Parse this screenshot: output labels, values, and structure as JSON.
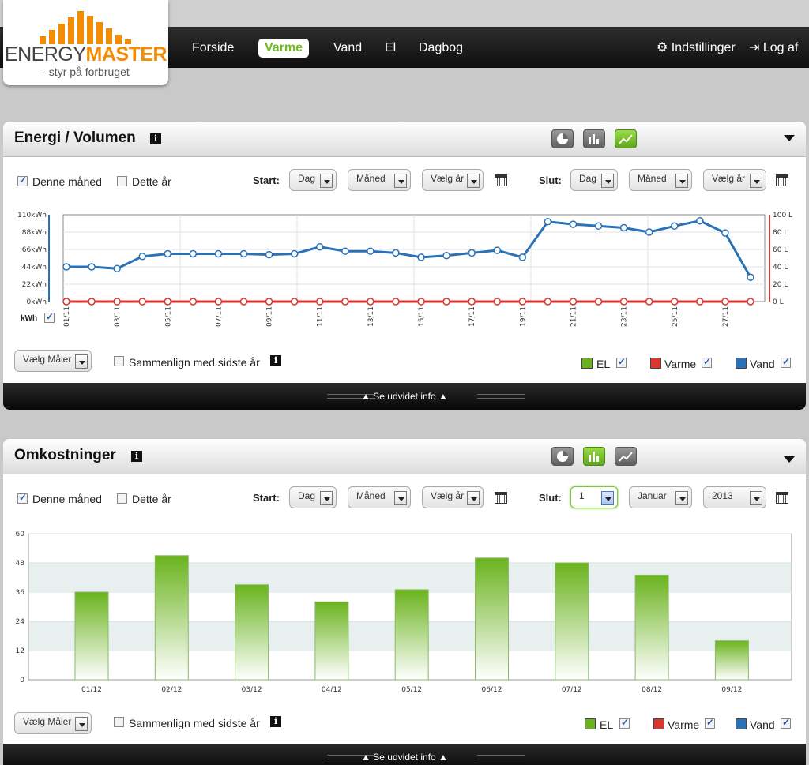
{
  "logo": {
    "word1": "ENERGY",
    "word2": "MASTER",
    "tagline": "- styr på forbruget"
  },
  "nav": {
    "items": [
      "Forside",
      "Varme",
      "Vand",
      "El",
      "Dagbog"
    ],
    "active": "Varme",
    "settings_label": "Indstillinger",
    "logout_label": "Log af"
  },
  "panel1": {
    "title": "Energi / Volumen",
    "info": "i",
    "this_month_label": "Denne måned",
    "this_year_label": "Dette år",
    "start_label": "Start",
    "end_label": "Slut:",
    "start_selects": [
      "Dag",
      "Måned",
      "Vælg år"
    ],
    "end_selects": [
      "Dag",
      "Måned",
      "Vælg år"
    ],
    "unit_toggle_label": "kWh",
    "meter_select": "Vælg Måler",
    "compare_label": "Sammenlign med sidste år",
    "legend": [
      {
        "label": "EL",
        "color": "#6ab31d"
      },
      {
        "label": "Varme",
        "color": "#d9362f"
      },
      {
        "label": "Vand",
        "color": "#2a72b8"
      }
    ],
    "expand_label": "Se udvidet info"
  },
  "panel2": {
    "title": "Omkostninger",
    "info": "i",
    "this_month_label": "Denne måned",
    "this_year_label": "Dette år",
    "start_label": "Start",
    "end_label": "Slut:",
    "start_selects": [
      "Dag",
      "Måned",
      "Vælg år"
    ],
    "end_selects": [
      "1",
      "Januar",
      "2013"
    ],
    "meter_select": "Vælg Måler",
    "compare_label": "Sammenlign med sidste år",
    "legend": [
      {
        "label": "EL",
        "color": "#6ab31d"
      },
      {
        "label": "Varme",
        "color": "#d9362f"
      },
      {
        "label": "Vand",
        "color": "#2a72b8"
      }
    ],
    "expand_label": "Se udvidet info"
  },
  "chart_data": [
    {
      "type": "line",
      "x": [
        "01/11",
        "02/11",
        "03/11",
        "04/11",
        "05/11",
        "06/11",
        "07/11",
        "08/11",
        "09/11",
        "10/11",
        "11/11",
        "12/11",
        "13/11",
        "14/11",
        "15/11",
        "16/11",
        "17/11",
        "18/11",
        "19/11",
        "20/11",
        "21/11",
        "22/11",
        "23/11",
        "24/11",
        "25/11",
        "26/11",
        "27/11",
        "28/11"
      ],
      "x_tick_labels": [
        "01/11",
        "03/11",
        "05/11",
        "07/11",
        "09/11",
        "11/11",
        "13/11",
        "15/11",
        "17/11",
        "19/11",
        "21/11",
        "23/11",
        "25/11",
        "27/11"
      ],
      "series": [
        {
          "name": "Vand",
          "axis": "right",
          "color": "#2a72b8",
          "values": [
            40,
            40,
            38,
            52,
            55,
            55,
            55,
            55,
            54,
            55,
            63,
            58,
            58,
            56,
            51,
            53,
            56,
            59,
            51,
            92,
            89,
            87,
            85,
            80,
            87,
            93,
            79,
            28
          ]
        },
        {
          "name": "Varme",
          "axis": "left",
          "color": "#d9362f",
          "values": [
            0,
            0,
            0,
            0,
            0,
            0,
            0,
            0,
            0,
            0,
            0,
            0,
            0,
            0,
            0,
            0,
            0,
            0,
            0,
            0,
            0,
            0,
            0,
            0,
            0,
            0,
            0,
            0
          ]
        }
      ],
      "y_left": {
        "ticks": [
          "0kWh",
          "22kWh",
          "44kWh",
          "66kWh",
          "88kWh",
          "110kWh"
        ],
        "lim": [
          0,
          110
        ]
      },
      "y_right": {
        "ticks": [
          "0 L",
          "20 L",
          "40 L",
          "60 L",
          "80 L",
          "100 L"
        ],
        "lim": [
          0,
          100
        ]
      },
      "grid": true
    },
    {
      "type": "bar",
      "categories": [
        "01/12",
        "02/12",
        "03/12",
        "04/12",
        "05/12",
        "06/12",
        "07/12",
        "08/12",
        "09/12"
      ],
      "values": [
        36,
        51,
        39,
        32,
        37,
        50,
        48,
        43,
        16
      ],
      "ylim": [
        0,
        60
      ],
      "y_ticks": [
        0,
        12,
        24,
        36,
        48,
        60
      ],
      "color": "#6ab31d"
    }
  ]
}
